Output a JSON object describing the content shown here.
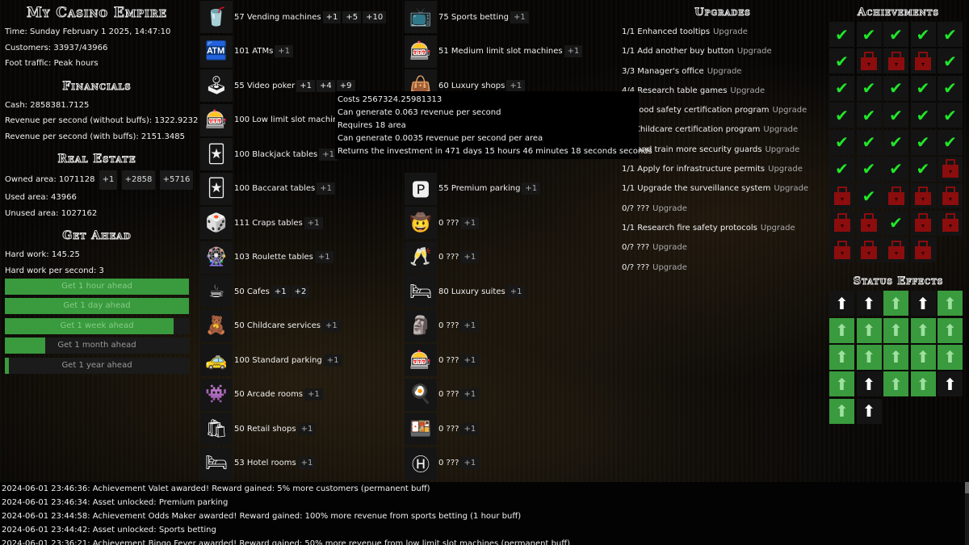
{
  "left": {
    "title": "My Casino Empire",
    "time": "Time: Sunday February 1 2025, 14:47:10",
    "customers": "Customers: 33937/43966",
    "foot_traffic": "Foot traffic: Peak hours",
    "financials_title": "Financials",
    "cash": "Cash: 2858381.7125",
    "rev_no_buffs": "Revenue per second (without buffs): 1322.9232",
    "rev_buffs": "Revenue per second (with buffs): 2151.3485",
    "real_estate_title": "Real Estate",
    "owned_area": "Owned area: 1071128",
    "owned_buttons": [
      "+1",
      "+2858",
      "+5716"
    ],
    "used_area": "Used area: 43966",
    "unused_area": "Unused area: 1027162",
    "get_ahead_title": "Get Ahead",
    "hard_work": "Hard work: 145.25",
    "hard_work_ps": "Hard work per second: 3",
    "get_ahead": [
      {
        "label": "Get 1 hour ahead",
        "progress": 1.0
      },
      {
        "label": "Get 1 day ahead",
        "progress": 1.0
      },
      {
        "label": "Get 1 week ahead",
        "progress": 0.915
      },
      {
        "label": "Get 1 month ahead",
        "progress": 0.22
      },
      {
        "label": "Get 1 year ahead",
        "progress": 0.02
      }
    ]
  },
  "assets_left": [
    {
      "label": "57 Vending machines",
      "icon": "vending-machine-icon",
      "glyph": "🥤",
      "buttons": [
        "+1",
        "+5",
        "+10"
      ]
    },
    {
      "label": "101 ATMs",
      "icon": "atm-icon",
      "glyph": "🏧",
      "buttons": [
        "+1"
      ]
    },
    {
      "label": "55 Video poker",
      "icon": "video-poker-icon",
      "glyph": "🕹",
      "buttons": [
        "+1",
        "+4",
        "+9"
      ]
    },
    {
      "label": "100 Low limit slot machin",
      "icon": "slot-machine-icon",
      "glyph": "🎰",
      "buttons": []
    },
    {
      "label": "100 Blackjack tables",
      "icon": "blackjack-icon",
      "glyph": "🃏",
      "buttons": [
        "+1"
      ]
    },
    {
      "label": "100 Baccarat tables",
      "icon": "baccarat-icon",
      "glyph": "🃏",
      "buttons": [
        "+1"
      ]
    },
    {
      "label": "111 Craps tables",
      "icon": "dice-icon",
      "glyph": "🎲",
      "buttons": [
        "+1"
      ]
    },
    {
      "label": "103 Roulette tables",
      "icon": "roulette-icon",
      "glyph": "🎡",
      "buttons": [
        "+1"
      ]
    },
    {
      "label": "50 Cafes",
      "icon": "coffee-icon",
      "glyph": "☕",
      "buttons": [
        "+1",
        "+2"
      ]
    },
    {
      "label": "50 Childcare services",
      "icon": "childcare-icon",
      "glyph": "🧸",
      "buttons": [
        "+1"
      ]
    },
    {
      "label": "100 Standard parking",
      "icon": "parking-icon",
      "glyph": "🚕",
      "buttons": [
        "+1"
      ]
    },
    {
      "label": "50 Arcade rooms",
      "icon": "arcade-icon",
      "glyph": "👾",
      "buttons": [
        "+1"
      ]
    },
    {
      "label": "50 Retail shops",
      "icon": "shopping-bag-icon",
      "glyph": "🛍",
      "buttons": [
        "+1"
      ]
    },
    {
      "label": "53 Hotel rooms",
      "icon": "bed-icon",
      "glyph": "🛏",
      "buttons": [
        "+1"
      ]
    }
  ],
  "assets_right": [
    {
      "label": "75 Sports betting",
      "icon": "sports-betting-icon",
      "glyph": "📺",
      "buttons": [
        "+1"
      ]
    },
    {
      "label": "51 Medium limit slot machines",
      "icon": "slot-machine-icon",
      "glyph": "🎰",
      "buttons": [
        "+1"
      ]
    },
    {
      "label": "60 Luxury shops",
      "icon": "luxury-bag-icon",
      "glyph": "👜",
      "buttons": [
        "+1"
      ]
    },
    {
      "label": "",
      "icon": "hidden-asset-icon",
      "glyph": "",
      "buttons": []
    },
    {
      "label": "",
      "icon": "hidden-asset-icon",
      "glyph": "",
      "buttons": []
    },
    {
      "label": "55 Premium parking",
      "icon": "garage-icon",
      "glyph": "🅿",
      "buttons": [
        "+1"
      ]
    },
    {
      "label": "0 ???",
      "icon": "cowboy-icon",
      "glyph": "🤠",
      "buttons": [
        "+1"
      ]
    },
    {
      "label": "0 ???",
      "icon": "champagne-icon",
      "glyph": "🥂",
      "buttons": [
        "+1"
      ]
    },
    {
      "label": "80 Luxury suites",
      "icon": "luxury-bed-icon",
      "glyph": "🛏",
      "buttons": [
        "+1"
      ]
    },
    {
      "label": "0 ???",
      "icon": "performer-icon",
      "glyph": "🗿",
      "buttons": [
        "+1"
      ]
    },
    {
      "label": "0 ???",
      "icon": "slot-machine-icon",
      "glyph": "🎰",
      "buttons": [
        "+1"
      ]
    },
    {
      "label": "0 ???",
      "icon": "dinner-plate-icon",
      "glyph": "🍳",
      "buttons": [
        "+1"
      ]
    },
    {
      "label": "0 ???",
      "icon": "buffet-icon",
      "glyph": "🍱",
      "buttons": [
        "+1"
      ]
    },
    {
      "label": "0 ???",
      "icon": "helipad-icon",
      "glyph": "Ⓗ",
      "buttons": [
        "+1"
      ]
    }
  ],
  "tooltip": [
    "Costs 2567324.25981313",
    "Can generate 0.063 revenue per second",
    "Requires 18 area",
    "Can generate 0.0035 revenue per second per area",
    "Returns the investment in 471 days 15 hours 46 minutes 18 seconds seconds"
  ],
  "upgrades": {
    "title": "Upgrades",
    "button_label": "Upgrade",
    "items": [
      "1/1 Enhanced tooltips",
      "1/1 Add another buy button",
      "3/3 Manager's office",
      "4/4 Research table games",
      "     Food safety certification program",
      "     Childcare certification program",
      "Hire and train more security guards",
      "1/1 Apply for infrastructure permits",
      "1/1 Upgrade the surveillance system",
      "0/? ???",
      "1/1 Research fire safety protocols",
      "0/? ???",
      "0/? ???"
    ]
  },
  "achievements": {
    "title": "Achievements",
    "colors": {
      "unlocked": "#22e52a",
      "locked": "#8b0d0d"
    },
    "states": [
      "u",
      "u",
      "u",
      "u",
      "u",
      "u",
      "l",
      "l",
      "l",
      "u",
      "u",
      "u",
      "u",
      "u",
      "u",
      "u",
      "u",
      "u",
      "u",
      "u",
      "u",
      "u",
      "u",
      "u",
      "u",
      "u",
      "u",
      "u",
      "u",
      "l",
      "l",
      "u",
      "l",
      "l",
      "l",
      "l",
      "l",
      "u",
      "l",
      "l",
      "l",
      "l",
      "l",
      "l"
    ]
  },
  "status_effects": {
    "title": "Status Effects",
    "active_color": "#3a9a3e",
    "states": [
      "w",
      "w",
      "g",
      "w",
      "g",
      "g",
      "g",
      "g",
      "g",
      "g",
      "g",
      "g",
      "g",
      "g",
      "g",
      "g",
      "w",
      "g",
      "g",
      "w",
      "g",
      "w"
    ]
  },
  "log": [
    "2024-06-01 23:46:36: Achievement Valet awarded! Reward gained: 5% more customers (permanent buff)",
    "2024-06-01 23:46:34: Asset unlocked: Premium parking",
    "2024-06-01 23:44:58: Achievement Odds Maker awarded! Reward gained: 100% more revenue from sports betting (1 hour buff)",
    "2024-06-01 23:44:42: Asset unlocked: Sports betting",
    "2024-06-01 23:36:21: Achievement Bingo Fever awarded! Reward gained: 50% more revenue from low limit slot machines (permanent buff)"
  ]
}
